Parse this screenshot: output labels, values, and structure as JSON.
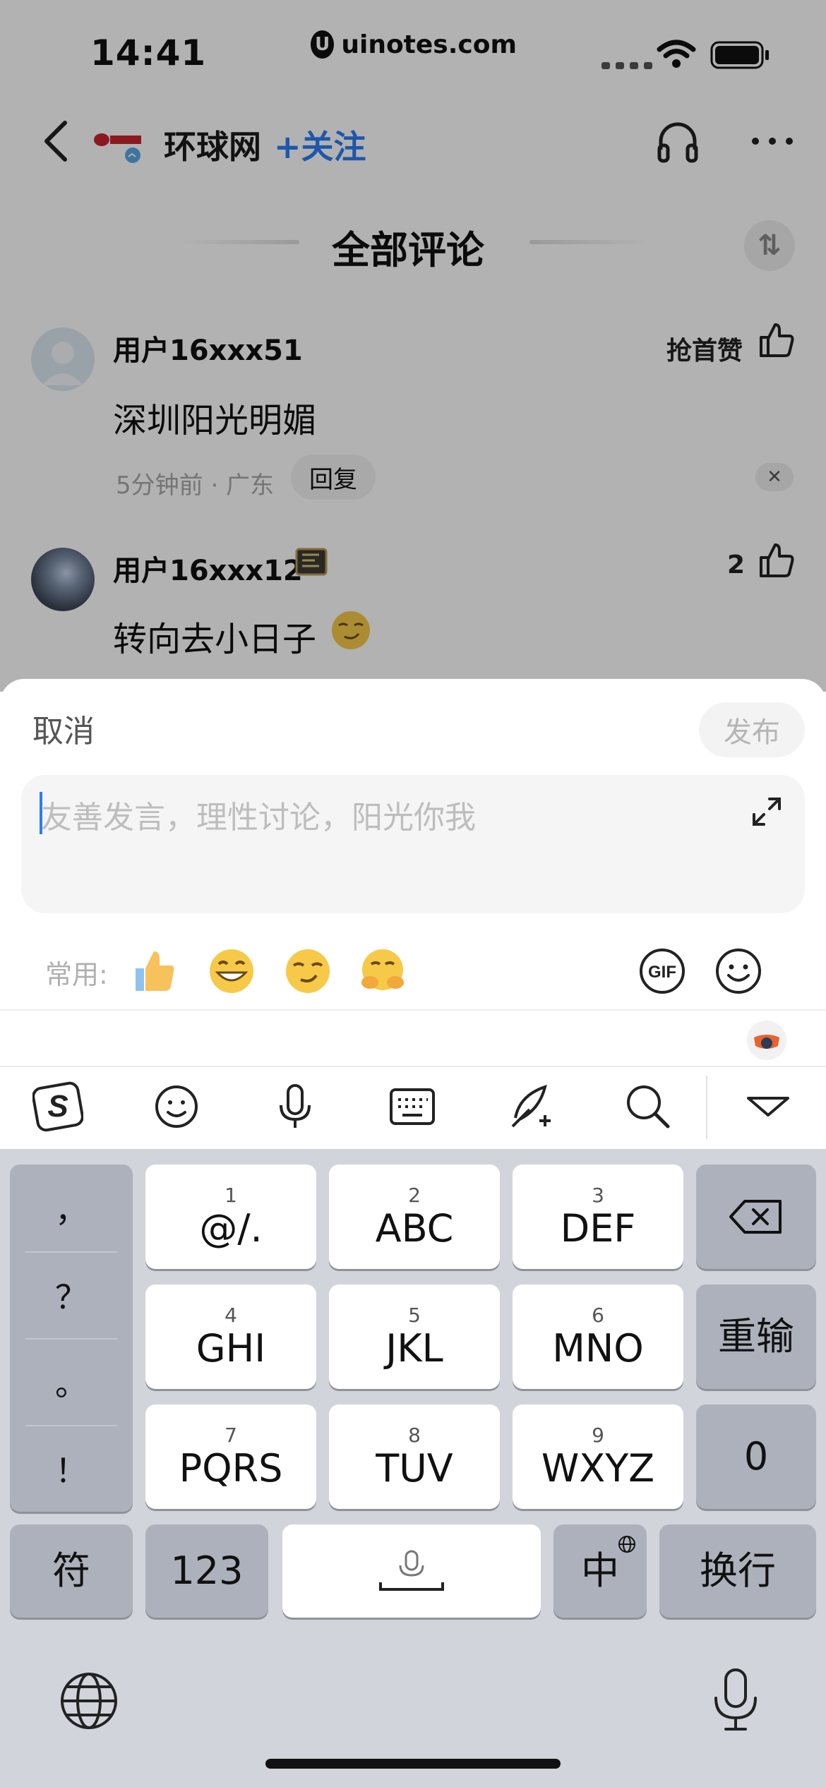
{
  "status_bar": {
    "time": "14:41",
    "watermark": "uinotes.com",
    "watermark_logo": "U"
  },
  "header": {
    "source_name": "环球网",
    "follow_label": "+关注"
  },
  "section": {
    "title": "全部评论",
    "sort_icon": "⇅"
  },
  "comments": [
    {
      "user": "用户16xxx51",
      "text": "深圳阳光明媚",
      "meta": "5分钟前 · 广东",
      "reply_label": "回复",
      "like_label": "抢首赞",
      "close_label": "✕"
    },
    {
      "user": "用户16xxx12",
      "text": "转向去小日子",
      "like_count": "2"
    }
  ],
  "composer": {
    "cancel_label": "取消",
    "publish_label": "发布",
    "placeholder": "友善发言，理性讨论，阳光你我",
    "common_label": "常用:",
    "quick_emojis": [
      "thumbs-up",
      "grin",
      "smirk",
      "hug"
    ]
  },
  "keyboard": {
    "punct_keys": [
      "，",
      "？",
      "。",
      "！"
    ],
    "t9_keys": [
      {
        "num": "1",
        "label": "@/."
      },
      {
        "num": "2",
        "label": "ABC"
      },
      {
        "num": "3",
        "label": "DEF"
      },
      {
        "num": "4",
        "label": "GHI"
      },
      {
        "num": "5",
        "label": "JKL"
      },
      {
        "num": "6",
        "label": "MNO"
      },
      {
        "num": "7",
        "label": "PQRS"
      },
      {
        "num": "8",
        "label": "TUV"
      },
      {
        "num": "9",
        "label": "WXYZ"
      }
    ],
    "reinput_label": "重输",
    "zero_label": "0",
    "symbol_label": "符",
    "num_label": "123",
    "lang_label": "中",
    "enter_label": "换行"
  }
}
